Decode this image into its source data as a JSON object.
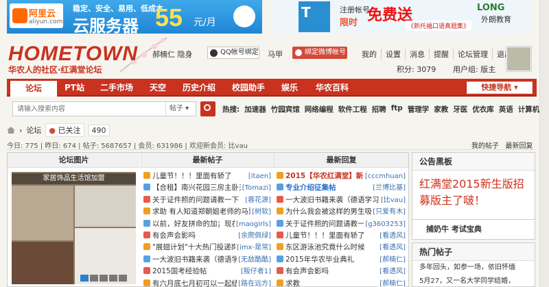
{
  "ads": {
    "left": {
      "logo_cn": "阿里云",
      "logo_url": "aliyun.com",
      "slogan": "稳定、安全、易用、低成本",
      "title": "云服务器",
      "price": "55",
      "unit": "元/月"
    },
    "right": {
      "register": "注册帐号",
      "limited": "限时",
      "free": "免费送",
      "book": "《新托福口语真题集》",
      "brand": "LONG",
      "brand_cn": "外朗教育"
    }
  },
  "header": {
    "logo_title": "HOMETOWN",
    "logo_sub": "华农人的社区·红满堂论坛",
    "user": "郝楠仁 隐身",
    "qq_button": "QQ帐号绑定",
    "user2": "马甲",
    "weibo_button": "绑定微博帐号",
    "top_links": [
      "我的",
      "设置",
      "消息",
      "提醒",
      "论坛管理",
      "退出"
    ],
    "credits": "积分: 3079",
    "usergroup": "用户组: 版主"
  },
  "nav": {
    "items": [
      "论坛",
      "PT站",
      "二手市场",
      "天空",
      "历史介绍",
      "校园助手",
      "娱乐",
      "华农百科"
    ],
    "quick": "快捷导航"
  },
  "search": {
    "placeholder": "请输入搜索内容",
    "scope": "帖子",
    "hot_label": "热搜:",
    "hot": [
      "加速器",
      "竹园宾馆",
      "网络编程",
      "软件工程",
      "招聘",
      "ftp",
      "管理学",
      "家教",
      "牙医",
      "优衣库",
      "英语",
      "计算机二级"
    ]
  },
  "crumb": {
    "forum": "论坛",
    "followed": "已关注",
    "count": "490"
  },
  "stats": {
    "text": "今日: 775 | 昨日: 674 | 帖子: 5687657 | 会员: 631986 | 欢迎新会员: 比vau",
    "my_posts": "我的帖子",
    "latest_reply": "最新回复"
  },
  "columns": {
    "photo": "论坛图片",
    "latest": "最新帖子",
    "replies": "最新回复"
  },
  "photo_caption": "家居饰品生活馆加盟",
  "latest_posts": [
    {
      "t": "儿童节！！！里面有轿了",
      "a": "[itaen]"
    },
    {
      "t": "【合租】南兴花园三房主卧天",
      "a": "[Tomazi]"
    },
    {
      "t": "关于证件照的问题请教一下",
      "a": "[蓉花源]"
    },
    {
      "t": "求助 有人知道郑朝姐老师的马票",
      "a": "[树软]"
    },
    {
      "t": "以前，好友拼命的加；现在，",
      "a": "[maogirls]"
    },
    {
      "t": "有会声会影吗",
      "a": "[余爬佩绿]"
    },
    {
      "t": "\"展翅计划\"十大热门投递岗位",
      "a": "[imx-是常]"
    },
    {
      "t": "一大波旧书籍来袭（德语学习",
      "a": "[无敌酷酷]"
    },
    {
      "t": "2015国考经验帖",
      "a": "[殷仔者1]"
    },
    {
      "t": "有六月底七月初可以一起结",
      "a": "[路在远方]"
    }
  ],
  "latest_replies": [
    {
      "t": "2015【华农红满堂】新",
      "a": "[cccmhuan]",
      "hl": true
    },
    {
      "t": "专业介绍征集帖",
      "a": "[兰博比基]",
      "hl2": true
    },
    {
      "t": "一大波旧书籍来袭（德语学习",
      "a": "[比vau]"
    },
    {
      "t": "为什么我会被这样的男生吸",
      "a": "[只爱有木]"
    },
    {
      "t": "关于证件照的问题请教一",
      "a": "[g3603253]"
    },
    {
      "t": "儿童节！！！里面有轿了",
      "a": "[看透风]"
    },
    {
      "t": "东区游泳池究竟什么时候",
      "a": "[看透风]"
    },
    {
      "t": "2015年华农毕业典礼",
      "a": "[郝楠仁]"
    },
    {
      "t": "有会声会影吗",
      "a": "[看透风]"
    },
    {
      "t": "求教",
      "a": "[郝楠仁]"
    }
  ],
  "notice": {
    "title": "公告黑板",
    "body": "红满堂2015新生版招募版主了啵！"
  },
  "side_links": "捕奶牛    考试宝典",
  "hot_threads": {
    "title": "热门帖子",
    "line1": "多年回头，如参一场，依旧怀缅",
    "line2": "5月27，又一名大学同学结婚，"
  },
  "colors": {
    "brand": "#c8321f",
    "link": "#3a6fb0"
  }
}
